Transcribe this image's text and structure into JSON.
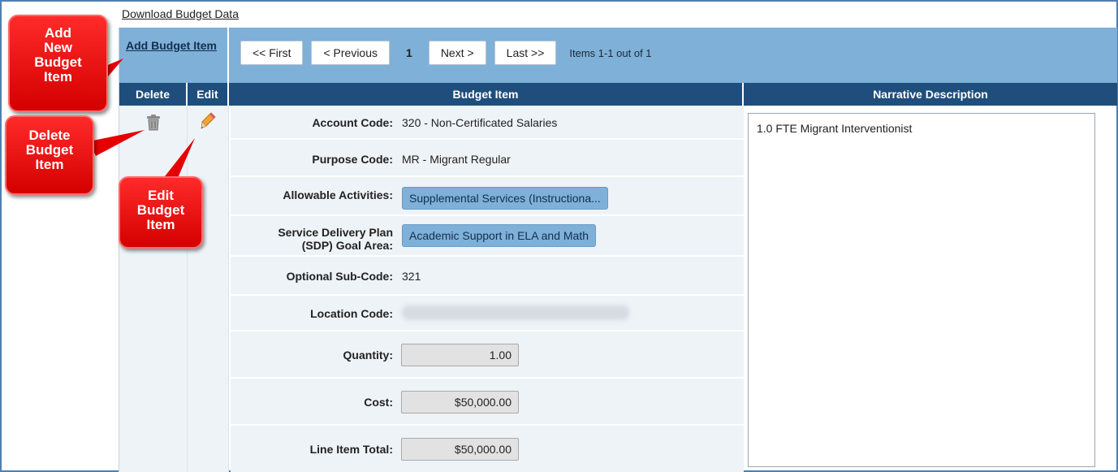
{
  "download_link": "Download Budget Data",
  "toolbar": {
    "add_item": "Add Budget Item",
    "first": "<< First",
    "previous": "< Previous",
    "current_page": "1",
    "next": "Next >",
    "last": "Last >>",
    "items_info": "Items 1-1 out of 1"
  },
  "columns": {
    "delete": "Delete",
    "edit": "Edit",
    "budget_item": "Budget Item",
    "narrative": "Narrative Description"
  },
  "item": {
    "account_code_label": "Account Code:",
    "account_code": "320 - Non-Certificated Salaries",
    "purpose_code_label": "Purpose Code:",
    "purpose_code": "MR - Migrant Regular",
    "allowable_label": "Allowable Activities:",
    "allowable": "Supplemental Services (Instructiona...",
    "sdp_label_1": "Service Delivery Plan",
    "sdp_label_2": "(SDP) Goal Area:",
    "sdp": "Academic Support in ELA and Math",
    "subcode_label": "Optional Sub-Code:",
    "subcode": "321",
    "location_label": "Location Code:",
    "quantity_label": "Quantity:",
    "quantity": "1.00",
    "cost_label": "Cost:",
    "cost": "$50,000.00",
    "total_label": "Line Item Total:",
    "total": "$50,000.00",
    "narrative": "1.0 FTE Migrant Interventionist"
  },
  "callouts": {
    "add": [
      "Add",
      "New",
      "Budget",
      "Item"
    ],
    "delete": [
      "Delete",
      "Budget",
      "Item"
    ],
    "edit": [
      "Edit",
      "Budget",
      "Item"
    ]
  },
  "colors": {
    "toolbar": "#7fb0d8",
    "header": "#1f4e7c",
    "callout": "#e60000"
  }
}
